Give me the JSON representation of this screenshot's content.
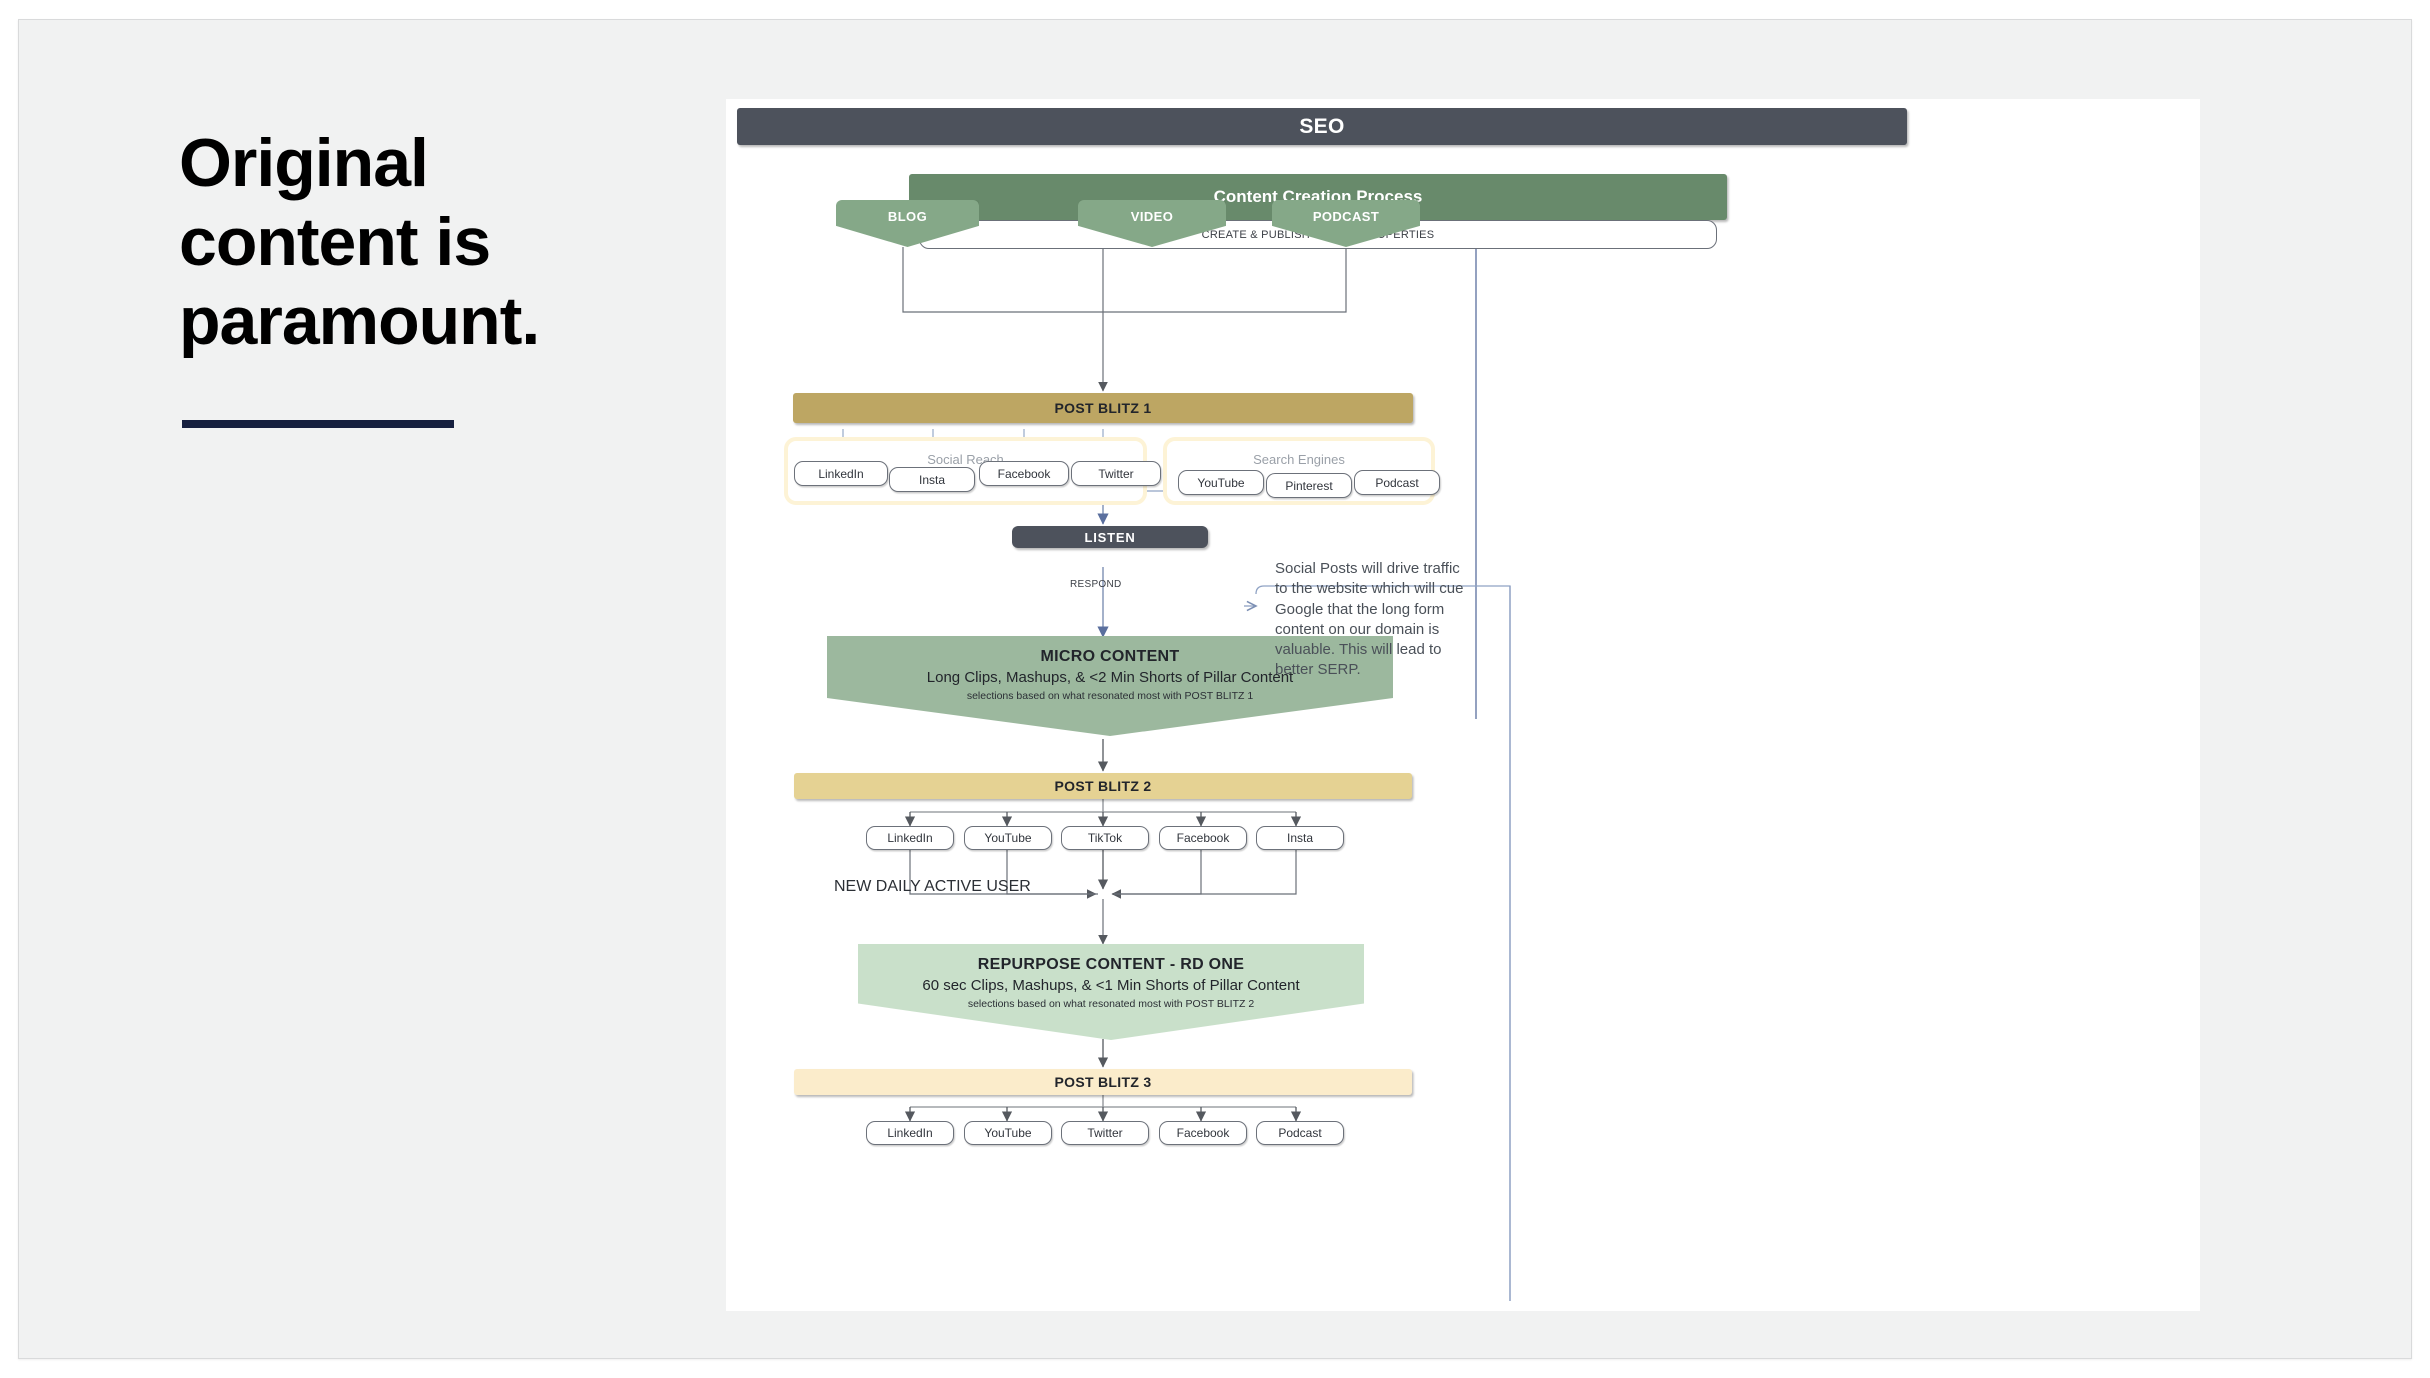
{
  "slide": {
    "headline": "Original\ncontent is\nparamount.",
    "accent_rule_color": "#16203f",
    "background_color": "#f1f2f2"
  },
  "diagram": {
    "title": "SEO",
    "title_color": "#4d525c",
    "pillar": {
      "label": "Content Creation Process",
      "color": "#688a6b"
    },
    "publish_step": {
      "label": "CREATE & PUBLISH TO WEB PROPERTIES"
    },
    "channels": [
      {
        "label": "BLOG"
      },
      {
        "label": "VIDEO"
      },
      {
        "label": "PODCAST"
      }
    ],
    "post_blitz_1": {
      "label": "POST BLITZ 1",
      "color": "#bda663"
    },
    "groups": [
      {
        "title": "Social Reach",
        "items": [
          "LinkedIn",
          "Insta",
          "Facebook",
          "Twitter"
        ]
      },
      {
        "title": "Search Engines",
        "items": [
          "YouTube",
          "Pinterest",
          "Podcast"
        ]
      }
    ],
    "listen": {
      "label": "LISTEN",
      "color": "#4d525c"
    },
    "respond_label": "RESPOND",
    "micro_content": {
      "title": "MICRO CONTENT",
      "subtitle": "Long Clips, Mashups, & <2 Min Shorts of Pillar Content",
      "note": "selections based on what resonated most with POST BLITZ 1",
      "color": "#9cb89e"
    },
    "post_blitz_2": {
      "label": "POST BLITZ 2",
      "color": "#e5d293",
      "items": [
        "LinkedIn",
        "YouTube",
        "TikTok",
        "Facebook",
        "Insta"
      ]
    },
    "new_daily_active_user_label": "NEW DAILY ACTIVE USER",
    "repurpose_content": {
      "title": "REPURPOSE CONTENT - RD ONE",
      "subtitle": "60 sec Clips, Mashups, & <1 Min Shorts of Pillar Content",
      "note": "selections based on what resonated most with POST BLITZ 2",
      "color": "#c9e0ca"
    },
    "post_blitz_3": {
      "label": "POST BLITZ 3",
      "color": "#fbeccb",
      "items": [
        "LinkedIn",
        "YouTube",
        "Twitter",
        "Facebook",
        "Podcast"
      ]
    },
    "side_note": "Social Posts will drive traffic to the website which will cue Google that the long form content on our domain is valuable. This will lead to better SERP."
  }
}
